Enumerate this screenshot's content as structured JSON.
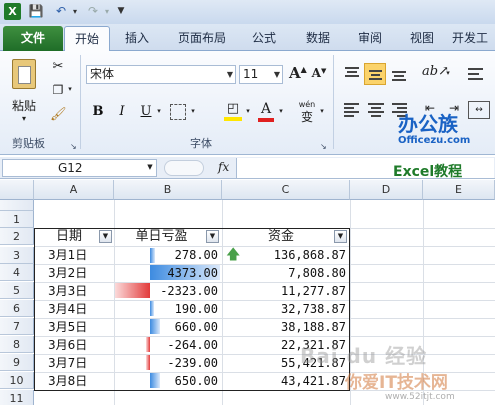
{
  "ribbon_tabs": [
    "文件",
    "开始",
    "插入",
    "页面布局",
    "公式",
    "数据",
    "审阅",
    "视图",
    "开发工"
  ],
  "clipboard": {
    "paste_label": "粘贴",
    "group_label": "剪贴板"
  },
  "font": {
    "name": "宋体",
    "size": "11",
    "group_label": "字体",
    "bold": "B",
    "italic": "I",
    "underline": "U",
    "grow": "A",
    "shrink": "A",
    "phonetic": "wén"
  },
  "watermarks": {
    "brand": "办公族",
    "brand_url": "Officezu.com",
    "excel_tutorial": "Excel教程",
    "baidu": "Bai du 经验",
    "site": "你爱IT技术网",
    "site_url": "www.52itjt.com"
  },
  "formula_bar": {
    "cell_ref": "G12",
    "fx": "fx"
  },
  "columns": [
    "A",
    "B",
    "C",
    "D",
    "E"
  ],
  "rows": [
    "1",
    "2",
    "3",
    "4",
    "5",
    "6",
    "7",
    "8",
    "9",
    "10",
    "11"
  ],
  "table": {
    "headers": [
      "日期",
      "单日亏盈",
      "资金"
    ],
    "rows": [
      {
        "date": "3月1日",
        "pl": "278.00",
        "fund": "136,868.87"
      },
      {
        "date": "3月2日",
        "pl": "4373.00",
        "fund": "7,808.80"
      },
      {
        "date": "3月3日",
        "pl": "-2323.00",
        "fund": "11,277.87"
      },
      {
        "date": "3月4日",
        "pl": "190.00",
        "fund": "32,738.87"
      },
      {
        "date": "3月5日",
        "pl": "660.00",
        "fund": "38,188.87"
      },
      {
        "date": "3月6日",
        "pl": "-264.00",
        "fund": "22,321.87"
      },
      {
        "date": "3月7日",
        "pl": "-239.00",
        "fund": "55,421.87"
      },
      {
        "date": "3月8日",
        "pl": "650.00",
        "fund": "43,421.87"
      }
    ]
  },
  "colors": {
    "positive_bar": "#3d8be0",
    "negative_bar": "#e23a3a",
    "file_tab": "#2a7a30",
    "up_arrow": "#4aa04a"
  }
}
